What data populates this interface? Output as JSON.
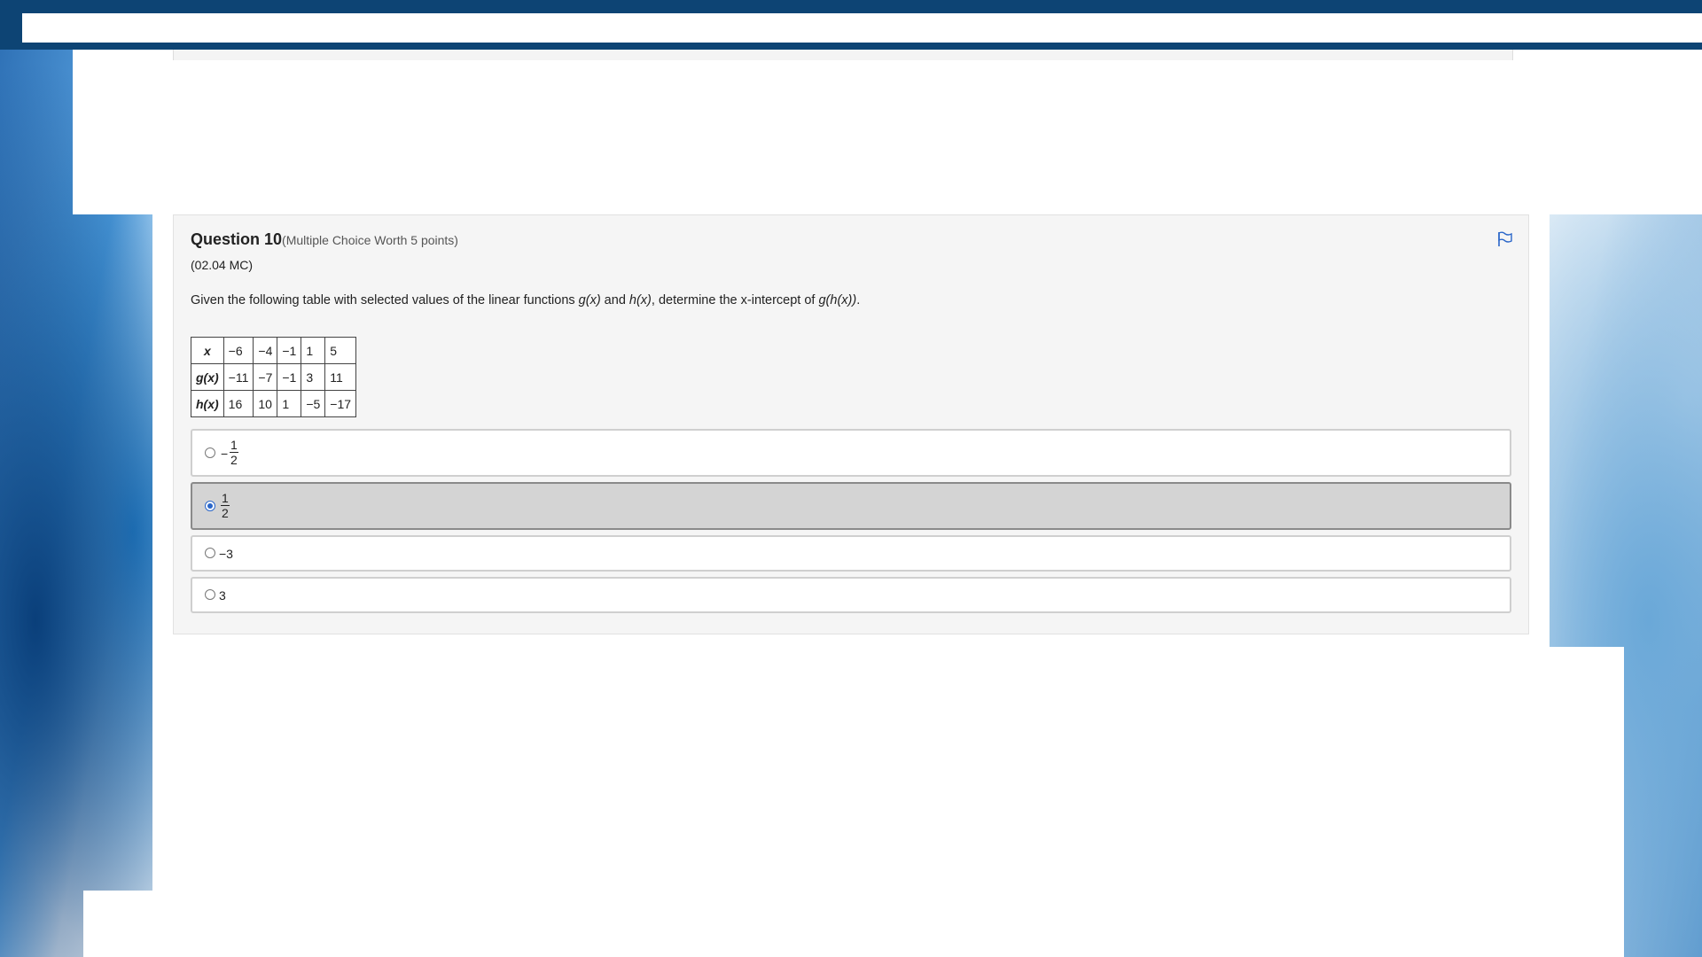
{
  "question": {
    "title": "Question 10",
    "worth": "(Multiple Choice Worth 5 points)",
    "code": "(02.04 MC)",
    "prompt_parts": [
      "Given the following table with selected values of the linear functions ",
      "g(x)",
      " and ",
      "h(x)",
      ", determine the x-intercept of ",
      "g(h(x))",
      "."
    ],
    "flag_icon": "flag-icon"
  },
  "table": {
    "rows": [
      {
        "head": "x",
        "cells": [
          "−6",
          "−4",
          "−1",
          "1",
          "5"
        ]
      },
      {
        "head": "g(x)",
        "cells": [
          "−11",
          "−7",
          "−1",
          "3",
          "11"
        ]
      },
      {
        "head": "h(x)",
        "cells": [
          "16",
          "10",
          "1",
          "−5",
          "−17"
        ]
      }
    ]
  },
  "choices": [
    {
      "type": "fraction",
      "sign": "−",
      "numerator": "1",
      "denominator": "2",
      "selected": false
    },
    {
      "type": "fraction",
      "sign": "",
      "numerator": "1",
      "denominator": "2",
      "selected": true
    },
    {
      "type": "text",
      "label": "−3",
      "selected": false
    },
    {
      "type": "text",
      "label": "3",
      "selected": false
    }
  ],
  "colors": {
    "topbar": "#0d4474",
    "radio_selected": "#2a66c9",
    "selected_choice_bg": "#d4d4d4",
    "flag": "#2a66c9"
  }
}
